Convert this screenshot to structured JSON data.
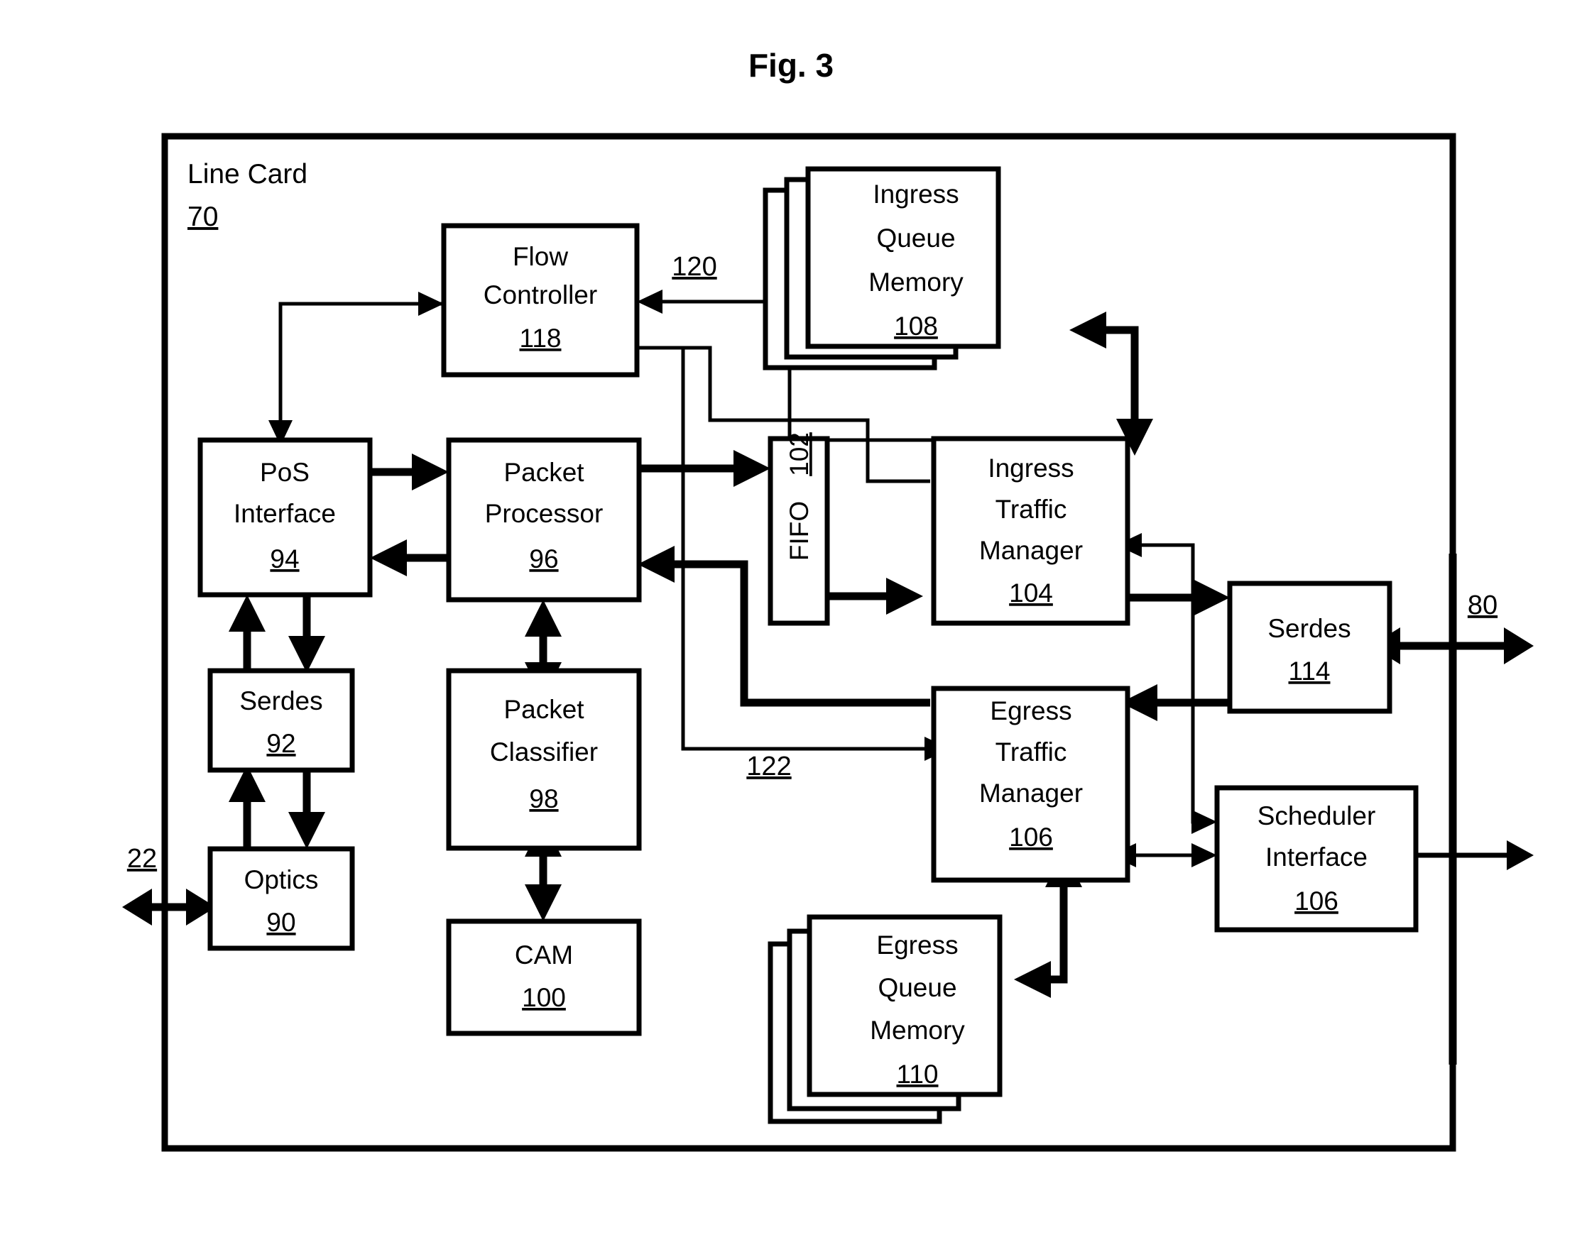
{
  "figure": {
    "title": "Fig. 3",
    "frame": {
      "label": "Line Card",
      "ref": "70"
    }
  },
  "blocks": {
    "flow_controller": {
      "line1": "Flow",
      "line2": "Controller",
      "ref": "118"
    },
    "pos_interface": {
      "line1": "PoS",
      "line2": "Interface",
      "ref": "94"
    },
    "packet_processor": {
      "line1": "Packet",
      "line2": "Processor",
      "ref": "96"
    },
    "packet_classifier": {
      "line1": "Packet",
      "line2": "Classifier",
      "ref": "98"
    },
    "cam": {
      "line1": "CAM",
      "ref": "100"
    },
    "serdes_92": {
      "line1": "Serdes",
      "ref": "92"
    },
    "optics_90": {
      "line1": "Optics",
      "ref": "90"
    },
    "fifo_102": {
      "label": "FIFO",
      "ref": "102"
    },
    "ingress_queue_memory": {
      "line1": "Ingress",
      "line2": "Queue",
      "line3": "Memory",
      "ref": "108"
    },
    "ingress_traffic_manager": {
      "line1": "Ingress",
      "line2": "Traffic",
      "line3": "Manager",
      "ref": "104"
    },
    "egress_traffic_manager": {
      "line1": "Egress",
      "line2": "Traffic",
      "line3": "Manager",
      "ref": "106"
    },
    "egress_queue_memory": {
      "line1": "Egress",
      "line2": "Queue",
      "line3": "Memory",
      "ref": "110"
    },
    "serdes_114": {
      "line1": "Serdes",
      "ref": "114"
    },
    "scheduler_interface": {
      "line1": "Scheduler",
      "line2": "Interface",
      "ref": "106"
    }
  },
  "lead_refs": {
    "ref_120": "120",
    "ref_122": "122",
    "ref_80": "80",
    "ref_22": "22"
  },
  "colors": {
    "stroke": "#000000",
    "background": "#ffffff"
  }
}
